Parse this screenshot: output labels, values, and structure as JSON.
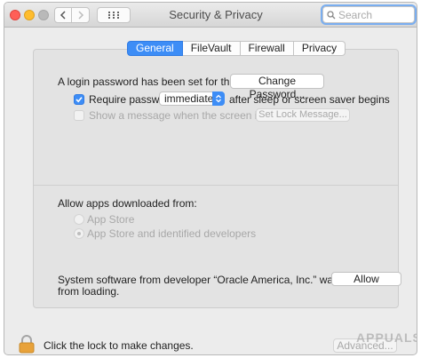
{
  "window": {
    "title": "Security & Privacy"
  },
  "search": {
    "placeholder": "Search"
  },
  "tabs": [
    {
      "label": "General",
      "active": true
    },
    {
      "label": "FileVault",
      "active": false
    },
    {
      "label": "Firewall",
      "active": false
    },
    {
      "label": "Privacy",
      "active": false
    }
  ],
  "general": {
    "login_password_text": "A login password has been set for this user",
    "change_password_label": "Change Password...",
    "require_password": {
      "checked": true,
      "label": "Require password",
      "select_value": "immediately",
      "suffix": "after sleep or screen saver begins"
    },
    "show_message": {
      "checked": false,
      "label": "Show a message when the screen is locked",
      "button_label": "Set Lock Message..."
    }
  },
  "allow_apps": {
    "heading": "Allow apps downloaded from:",
    "options": [
      {
        "label": "App Store",
        "selected": false
      },
      {
        "label": "App Store and identified developers",
        "selected": true
      }
    ]
  },
  "blocked_notice": {
    "text_line1": "System software from developer “Oracle America, Inc.” was blocked",
    "text_line2": "from loading.",
    "allow_label": "Allow"
  },
  "footer": {
    "lock_text": "Click the lock to make changes.",
    "advanced_label": "Advanced..."
  },
  "watermark": "APPUALS",
  "colors": {
    "accent": "#3d8df6",
    "window_bg": "#ececec",
    "panel_bg": "#e3e3e3"
  }
}
